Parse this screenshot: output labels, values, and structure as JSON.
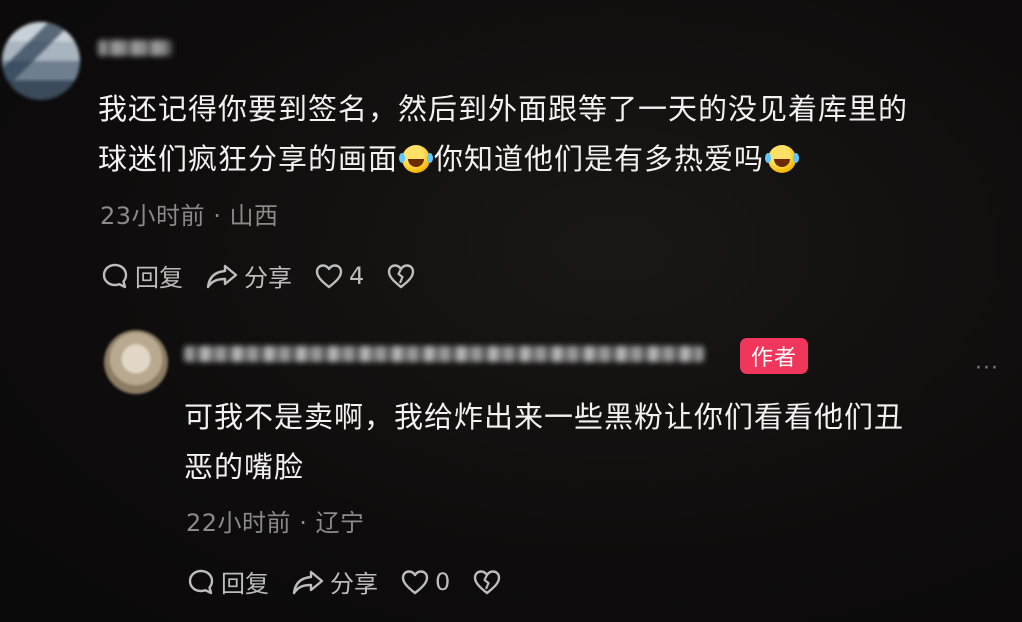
{
  "comment": {
    "text_line1": "我还记得你要到签名，然后到外面跟等了一天的没见着库里的",
    "text_line2a": "球迷们疯狂分享的画面",
    "text_line2b": "你知道他们是有多热爱吗",
    "timestamp": "23小时前",
    "separator": "·",
    "location": "山西",
    "reply_label": "回复",
    "share_label": "分享",
    "like_count": "4"
  },
  "reply": {
    "author_badge": "作者",
    "more_label": "···",
    "text_line1": "可我不是卖啊，我给炸出来一些黑粉让你们看看他们丑",
    "text_line2": "恶的嘴脸",
    "timestamp": "22小时前",
    "separator": "·",
    "location": "辽宁",
    "reply_label": "回复",
    "share_label": "分享",
    "like_count": "0"
  },
  "icons": {
    "reply": "speech-bubble-icon",
    "share": "share-arrow-icon",
    "like": "heart-outline-icon",
    "dislike": "broken-heart-icon",
    "emoji": "rofl-emoji-icon"
  },
  "colors": {
    "background": "#0d0b0b",
    "text": "#f2f2f2",
    "meta": "#8a8a8a",
    "action": "#bdbdbd",
    "badge": "#f0365a"
  }
}
